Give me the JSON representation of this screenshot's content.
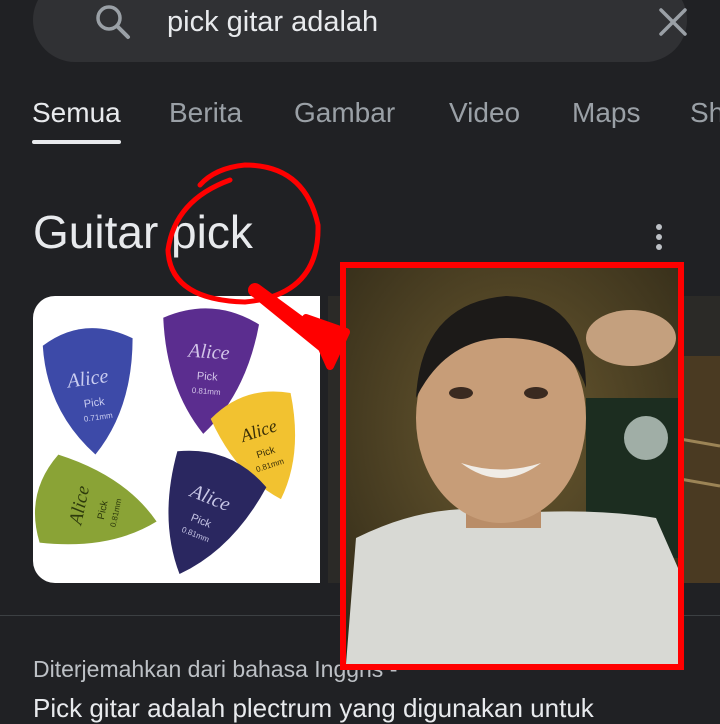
{
  "search": {
    "query": "pick gitar adalah",
    "search_icon": "search-icon",
    "clear_icon": "close-icon"
  },
  "tabs": [
    {
      "label": "Semua",
      "active": true
    },
    {
      "label": "Berita",
      "active": false
    },
    {
      "label": "Gambar",
      "active": false
    },
    {
      "label": "Video",
      "active": false
    },
    {
      "label": "Maps",
      "active": false
    },
    {
      "label": "Sh",
      "active": false
    }
  ],
  "knowledge_panel": {
    "title": "Guitar pick",
    "more_icon": "more-vert-icon"
  },
  "picks": [
    {
      "brand": "Alice",
      "label": "Pick",
      "gauge": "0.71mm",
      "color": "#3d4aa8"
    },
    {
      "brand": "Alice",
      "label": "Pick",
      "gauge": "0.81mm",
      "color": "#5b2d8f"
    },
    {
      "brand": "Alice",
      "label": "Pick",
      "gauge": "0.81mm",
      "color": "#f2c230"
    },
    {
      "brand": "Alice",
      "label": "Pick",
      "gauge": "0.81mm",
      "color": "#8aa336"
    },
    {
      "brand": "Alice",
      "label": "Pick",
      "gauge": "0.81mm",
      "color": "#2a2760"
    }
  ],
  "result": {
    "translated_note": "Diterjemahkan dari bahasa Inggris -",
    "snippet": "Pick gitar adalah plectrum yang digunakan untuk"
  },
  "annotation": {
    "color": "#ff0000"
  },
  "colors": {
    "background": "#202124",
    "surface": "#303134",
    "text": "#e8eaed",
    "muted": "#9aa0a6"
  }
}
